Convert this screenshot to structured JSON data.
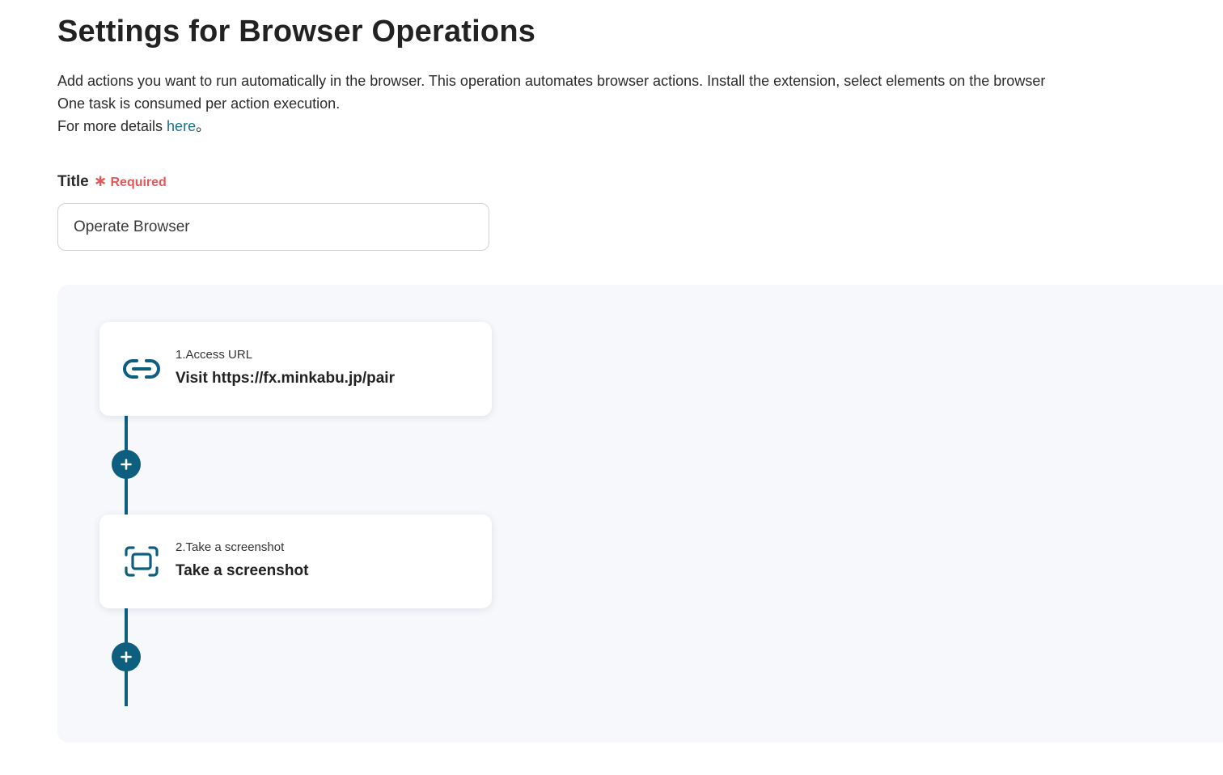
{
  "header": {
    "title": "Settings for Browser Operations"
  },
  "description": {
    "line1": "Add actions you want to run automatically in the browser. This operation automates browser actions. Install the extension, select elements on the browser",
    "line2": "One task is consumed per action execution.",
    "line3_prefix": "For more details ",
    "line3_link": "here",
    "line3_suffix": "。"
  },
  "title_field": {
    "label": "Title",
    "required_label": "Required",
    "value": "Operate Browser"
  },
  "steps": [
    {
      "number_label": "1.Access URL",
      "title": "Visit https://fx.minkabu.jp/pair",
      "icon": "link-icon"
    },
    {
      "number_label": "2.Take a screenshot",
      "title": "Take a screenshot",
      "icon": "screenshot-icon"
    }
  ],
  "colors": {
    "accent": "#0d5e7f",
    "required": "#e4585a",
    "link": "#1a6f8a",
    "canvas_background": "#f6f8fb"
  }
}
